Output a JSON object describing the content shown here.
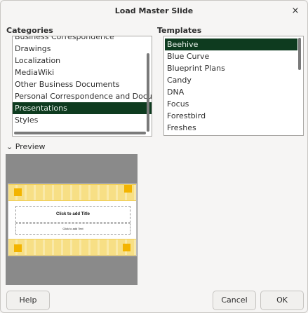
{
  "dialog": {
    "title": "Load Master Slide"
  },
  "categories": {
    "label": "Categories",
    "items": [
      "Business Correspondence",
      "Drawings",
      "Localization",
      "MediaWiki",
      "Other Business Documents",
      "Personal Correspondence and Documents",
      "Presentations",
      "Styles"
    ],
    "selected": "Presentations"
  },
  "templates": {
    "label": "Templates",
    "items": [
      "Beehive",
      "Blue Curve",
      "Blueprint Plans",
      "Candy",
      "DNA",
      "Focus",
      "Forestbird",
      "Freshes"
    ],
    "selected": "Beehive"
  },
  "preview": {
    "toggle_label": "Preview",
    "title_placeholder": "Click to add Title",
    "text_placeholder": "Click to add Text"
  },
  "buttons": {
    "help": "Help",
    "cancel": "Cancel",
    "ok": "OK"
  },
  "colors": {
    "selection_bg": "#0e3b1f",
    "selection_fg": "#e9f2eb"
  }
}
